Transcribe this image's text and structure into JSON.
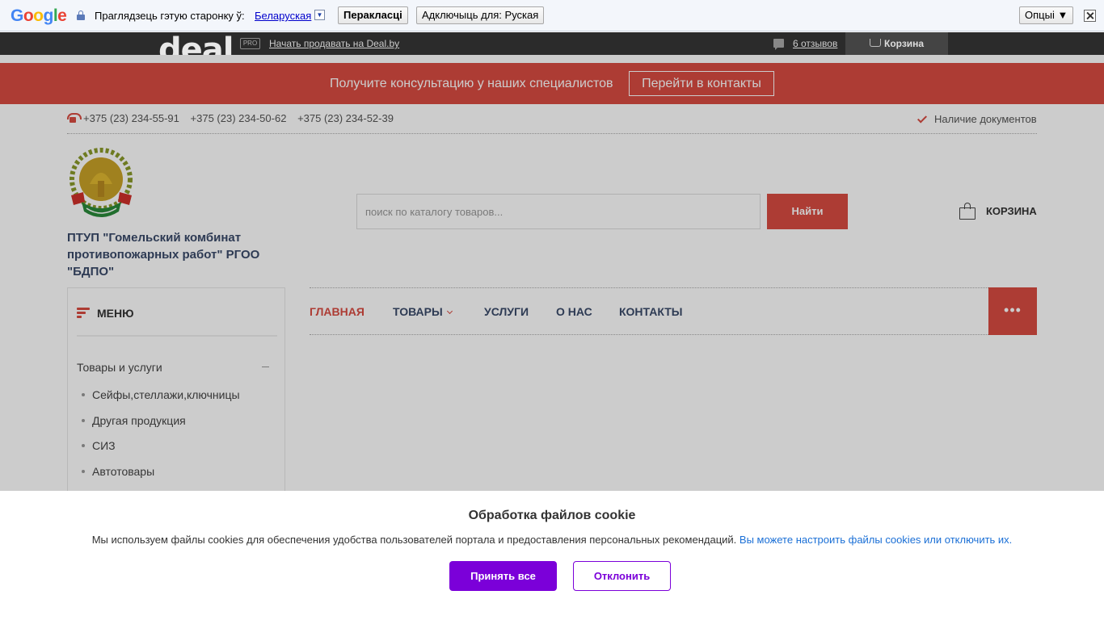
{
  "translate_bar": {
    "logo": "Google",
    "prompt": "Праглядзець гэтую старонку ў:",
    "language": "Беларуская",
    "translate_button": "Перакласці",
    "disable_button": "Адключыць для: Руская",
    "options_button": "Опцыі ▼",
    "logo_colors": [
      "#4285f4",
      "#ea4335",
      "#fbbc05",
      "#4285f4",
      "#34a853",
      "#ea4335"
    ]
  },
  "deal_bar": {
    "logo": "deal",
    "pro_badge": "PRO",
    "sell_link": "Начать продавать на Deal.by",
    "reviews_link": "6 отзывов",
    "cart_label": "Корзина"
  },
  "consult_bar": {
    "text": "Получите консультацию у наших специалистов",
    "button": "Перейти в контакты",
    "color": "#d94b42"
  },
  "contacts": {
    "phones": [
      "+375 (23) 234-55-91",
      "+375 (23) 234-50-62",
      "+375 (23) 234-52-39"
    ],
    "documents": "Наличие документов"
  },
  "header": {
    "company_name": "ПТУП \"Гомельский комбинат противопожарных работ\" РГОО \"БДПО\"",
    "search_placeholder": "поиск по каталогу товаров...",
    "search_button": "Найти",
    "cart_label": "КОРЗИНА"
  },
  "sidebar": {
    "menu_label": "МЕНЮ",
    "group_label": "Товары и услуги",
    "items": [
      "Сейфы,стеллажи,ключницы",
      "Другая продукция",
      "СИЗ",
      "Автотовары"
    ]
  },
  "nav": {
    "items": [
      "ГЛАВНАЯ",
      "ТОВАРЫ",
      "УСЛУГИ",
      "О НАС",
      "КОНТАКТЫ"
    ],
    "more": "•••"
  },
  "cookie": {
    "title": "Обработка файлов cookie",
    "text": "Мы используем файлы cookies для обеспечения удобства пользователей портала и предоставления персональных рекомендаций.",
    "link": "Вы можете настроить файлы cookies или отключить их.",
    "accept": "Принять все",
    "decline": "Отклонить",
    "accent": "#7b00d9"
  }
}
